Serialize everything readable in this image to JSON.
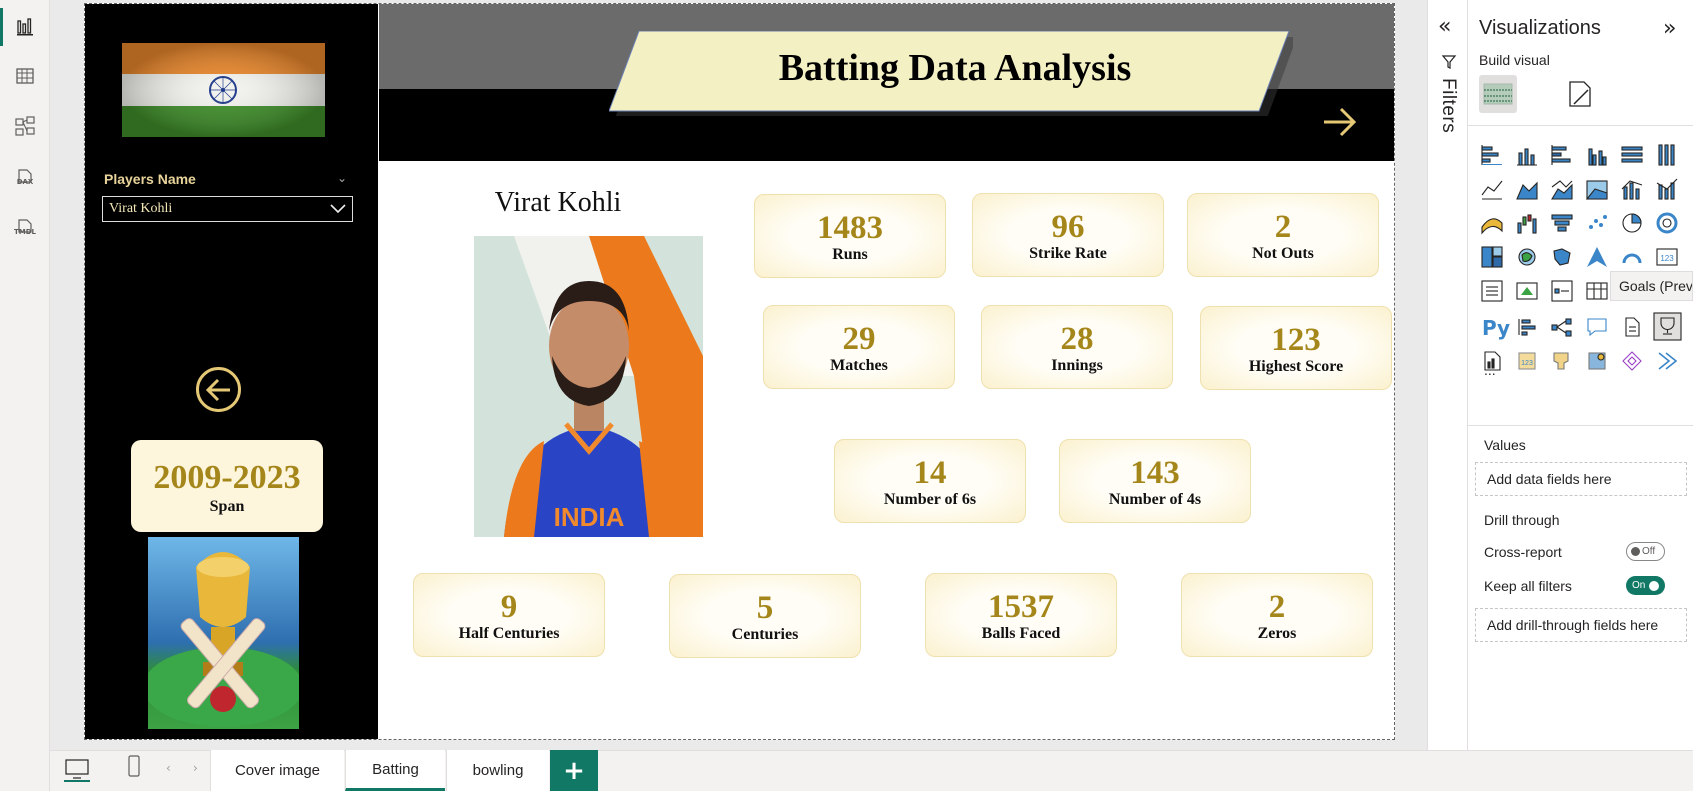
{
  "left_rail": {
    "items": [
      {
        "icon": "report-view-icon",
        "active": true
      },
      {
        "icon": "table-view-icon"
      },
      {
        "icon": "model-view-icon"
      },
      {
        "icon": "dax-query-icon",
        "label": "DAX"
      },
      {
        "icon": "tmdl-view-icon",
        "label": "TMDL"
      }
    ]
  },
  "report": {
    "title": "Batting Data Analysis",
    "slicer": {
      "label": "Players Name",
      "value": "Virat Kohli"
    },
    "span": {
      "value": "2009-2023",
      "label": "Span"
    },
    "player_name": "Virat Kohli",
    "cards": [
      {
        "value": "1483",
        "label": "Runs"
      },
      {
        "value": "96",
        "label": "Strike Rate"
      },
      {
        "value": "2",
        "label": "Not Outs"
      },
      {
        "value": "29",
        "label": "Matches"
      },
      {
        "value": "28",
        "label": "Innings"
      },
      {
        "value": "123",
        "label": "Highest Score"
      },
      {
        "value": "14",
        "label": "Number of 6s"
      },
      {
        "value": "143",
        "label": "Number of 4s"
      },
      {
        "value": "9",
        "label": "Half Centuries"
      },
      {
        "value": "5",
        "label": "Centuries"
      },
      {
        "value": "1537",
        "label": "Balls Faced"
      },
      {
        "value": "2",
        "label": "Zeros"
      }
    ],
    "colors": {
      "accent_gold": "#a5861a",
      "card_bg": "#fdf5dc",
      "banner_bg": "#f3f1c4",
      "dark": "#000000"
    }
  },
  "filters_pane": {
    "label": "Filters"
  },
  "visualizations": {
    "title": "Visualizations",
    "build_visual": "Build visual",
    "tooltip": "Goals (Prev",
    "more": "...",
    "values_label": "Values",
    "values_placeholder": "Add data fields here",
    "drill_through_label": "Drill through",
    "cross_report_label": "Cross-report",
    "cross_report_state": "Off",
    "keep_filters_label": "Keep all filters",
    "keep_filters_state": "On",
    "drill_placeholder": "Add drill-through fields here"
  },
  "pages": {
    "tabs": [
      "Cover image",
      "Batting",
      "bowling"
    ],
    "active": "Batting",
    "add_label": "+"
  },
  "theme_color": "#117865"
}
